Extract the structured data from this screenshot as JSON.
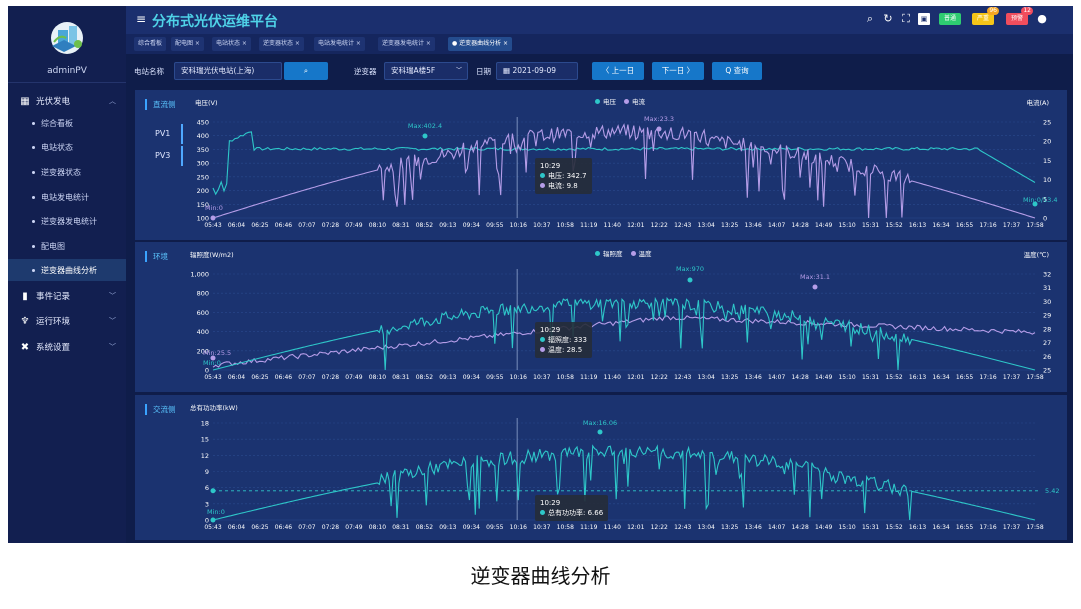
{
  "header": {
    "title": "分布式光伏运维平台",
    "alarms": [
      {
        "label": "普通",
        "color": "#2ecc71",
        "count": ""
      },
      {
        "label": "严重",
        "color": "#f5c518",
        "count": "96"
      },
      {
        "label": "预警",
        "color": "#f04d5d",
        "count": "12"
      }
    ]
  },
  "sidebar": {
    "user": "adminPV",
    "groups": [
      {
        "label": "光伏发电",
        "icon": "grid-icon",
        "expanded": true
      },
      {
        "label": "事件记录",
        "icon": "record-icon",
        "expanded": false
      },
      {
        "label": "运行环境",
        "icon": "environment-icon",
        "expanded": false
      },
      {
        "label": "系统设置",
        "icon": "tools-icon",
        "expanded": false
      }
    ],
    "items": [
      "综合看板",
      "电站状态",
      "逆变器状态",
      "电站发电统计",
      "逆变器发电统计",
      "配电图",
      "逆变器曲线分析"
    ],
    "active_item": "逆变器曲线分析"
  },
  "tabs": [
    "综合看板",
    "配电图 ×",
    "电站状态 ×",
    "逆变器状态 ×",
    "电站发电统计 ×",
    "逆变器发电统计 ×",
    "● 逆变器曲线分析 ×"
  ],
  "filters": {
    "station_label": "电站名称",
    "station_value": "安科瑞光伏电站(上海)",
    "inverter_label": "逆变器",
    "inverter_value": "安科瑞A楼5F",
    "date_label": "日期",
    "date_value": "2021-09-09",
    "prev_label": "〈 上一日",
    "next_label": "下一日 〉",
    "query_label": "Q 查询"
  },
  "time_ticks": [
    "05:43",
    "06:04",
    "06:25",
    "06:46",
    "07:07",
    "07:28",
    "07:49",
    "08:10",
    "08:31",
    "08:52",
    "09:13",
    "09:34",
    "09:55",
    "10:16",
    "10:37",
    "10:58",
    "11:19",
    "11:40",
    "12:01",
    "12:22",
    "12:43",
    "13:04",
    "13:25",
    "13:46",
    "14:07",
    "14:28",
    "14:49",
    "15:10",
    "15:31",
    "15:52",
    "16:13",
    "16:34",
    "16:55",
    "17:16",
    "17:37",
    "17:58"
  ],
  "panels": {
    "dc": {
      "tag": "直流侧",
      "left_axis": "电压(V)",
      "right_axis": "电流(A)",
      "pv_buttons": [
        "PV1",
        "PV3"
      ],
      "legend": [
        {
          "name": "电压",
          "color": "#2ec7c9"
        },
        {
          "name": "电流",
          "color": "#b59de8"
        }
      ],
      "left_ticks": [
        "450",
        "400",
        "350",
        "300",
        "250",
        "200",
        "150",
        "100"
      ],
      "right_ticks": [
        "25",
        "20",
        "15",
        "10",
        "5",
        "0"
      ],
      "annotations": {
        "max_v": "Max:402.4",
        "max_i": "Max:23.3",
        "min_v": "Min:0",
        "min_i": "Min:0",
        "end_v": "13.4"
      },
      "tooltip": {
        "time": "10:29",
        "lines": [
          "电压: 342.7",
          "电流: 9.8"
        ]
      }
    },
    "env": {
      "tag": "环境",
      "left_axis": "辐照度(W/m2)",
      "right_axis": "温度(℃)",
      "legend": [
        {
          "name": "辐照度",
          "color": "#2ec7c9"
        },
        {
          "name": "温度",
          "color": "#b59de8"
        }
      ],
      "left_ticks": [
        "1,000",
        "800",
        "600",
        "400",
        "200",
        "0"
      ],
      "right_ticks": [
        "32",
        "31",
        "30",
        "29",
        "28",
        "27",
        "26",
        "25"
      ],
      "annotations": {
        "max_r": "Max:970",
        "max_t": "Max:31.1",
        "min_t": "Min:25.5",
        "min_r": "Min:0"
      },
      "tooltip": {
        "time": "10:29",
        "lines": [
          "辐照度: 333",
          "温度: 28.5"
        ]
      }
    },
    "ac": {
      "tag": "交流侧",
      "left_axis": "总有功功率(kW)",
      "left_ticks": [
        "18",
        "15",
        "12",
        "9",
        "6",
        "3",
        "0"
      ],
      "annotations": {
        "max": "Max:16.06",
        "min": "Min:0",
        "avg": "5.42"
      },
      "tooltip": {
        "time": "10:29",
        "lines": [
          "总有功功率: 6.66"
        ]
      }
    }
  },
  "caption": "逆变器曲线分析",
  "colors": {
    "cyan": "#2ec7c9",
    "purple": "#b59de8"
  }
}
